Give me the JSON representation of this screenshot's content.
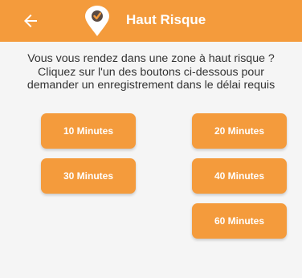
{
  "appbar": {
    "title": "Haut Risque",
    "back_icon": "arrow-left-icon",
    "logo_icon": "location-check-icon",
    "background_color": "#f49b3c"
  },
  "message": {
    "line1": "Vous vous rendez dans une zone à haut risque ?",
    "line2": "Cliquez sur l'un des boutons ci-dessous pour",
    "line3": "demander un enregistrement dans le délai requis"
  },
  "buttons": {
    "b10": "10 Minutes",
    "b20": "20 Minutes",
    "b30": "30 Minutes",
    "b40": "40 Minutes",
    "b60": "60 Minutes"
  },
  "colors": {
    "accent": "#f49b3c",
    "text": "#333333",
    "background": "#f5f5f5"
  }
}
